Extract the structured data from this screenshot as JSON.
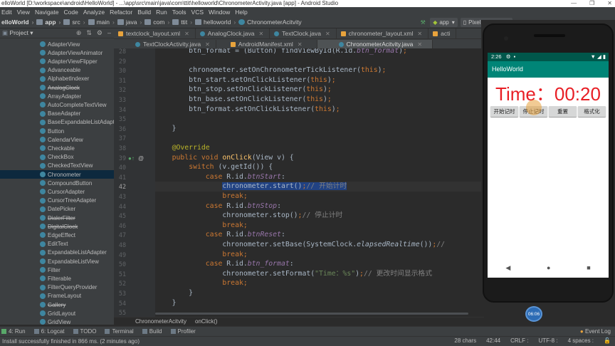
{
  "window": {
    "title": "elloWorld [D:\\workspace\\android\\HelloWorld] - ...\\app\\src\\main\\java\\com\\ttit\\helloworld\\ChronometerActivity.java [app] - Android Studio"
  },
  "menu": [
    "Edit",
    "View",
    "Navigate",
    "Code",
    "Analyze",
    "Refactor",
    "Build",
    "Run",
    "Tools",
    "VCS",
    "Window",
    "Help"
  ],
  "nav": {
    "crumbs": [
      "elloWorld",
      "app",
      "src",
      "main",
      "java",
      "com",
      "ttit",
      "helloworld",
      "ChronometerAcitvity"
    ],
    "run_config": "app",
    "device": "Pixel 2 API 28"
  },
  "project": {
    "header": "Project"
  },
  "tree": [
    {
      "label": "AdapterView",
      "strike": false
    },
    {
      "label": "AdapterViewAnimator",
      "strike": false
    },
    {
      "label": "AdapterViewFlipper",
      "strike": false
    },
    {
      "label": "Advanceable",
      "strike": false
    },
    {
      "label": "AlphabetIndexer",
      "strike": false
    },
    {
      "label": "AnalogClock",
      "strike": true
    },
    {
      "label": "ArrayAdapter",
      "strike": false
    },
    {
      "label": "AutoCompleteTextView",
      "strike": false
    },
    {
      "label": "BaseAdapter",
      "strike": false
    },
    {
      "label": "BaseExpandableListAdapter",
      "strike": false
    },
    {
      "label": "Button",
      "strike": false
    },
    {
      "label": "CalendarView",
      "strike": false
    },
    {
      "label": "Checkable",
      "strike": false
    },
    {
      "label": "CheckBox",
      "strike": false
    },
    {
      "label": "CheckedTextView",
      "strike": false
    },
    {
      "label": "Chronometer",
      "strike": false
    },
    {
      "label": "CompoundButton",
      "strike": false
    },
    {
      "label": "CursorAdapter",
      "strike": false
    },
    {
      "label": "CursorTreeAdapter",
      "strike": false
    },
    {
      "label": "DatePicker",
      "strike": false
    },
    {
      "label": "DialerFilter",
      "strike": true
    },
    {
      "label": "DigitalClock",
      "strike": true
    },
    {
      "label": "EdgeEffect",
      "strike": false
    },
    {
      "label": "EditText",
      "strike": false
    },
    {
      "label": "ExpandableListAdapter",
      "strike": false
    },
    {
      "label": "ExpandableListView",
      "strike": false
    },
    {
      "label": "Filter",
      "strike": false
    },
    {
      "label": "Filterable",
      "strike": false
    },
    {
      "label": "FilterQueryProvider",
      "strike": false
    },
    {
      "label": "FrameLayout",
      "strike": false
    },
    {
      "label": "Gallery",
      "strike": true
    },
    {
      "label": "GridLayout",
      "strike": false
    },
    {
      "label": "GridView",
      "strike": false
    }
  ],
  "tree_selected": "Chronometer",
  "tabs_row1": [
    "textclock_layout.xml",
    "AnalogClock.java",
    "TextClock.java",
    "chronometer_layout.xml",
    "acti"
  ],
  "tabs_row2": [
    "TextClockActivity.java",
    "AndroidManifest.xml",
    "ChronometerAcitvity.java"
  ],
  "active_tab": "ChronometerAcitvity.java",
  "line_numbers": [
    "28",
    "29",
    "30",
    "31",
    "32",
    "33",
    "34",
    "35",
    "36",
    "37",
    "38",
    "39",
    "40",
    "41",
    "42",
    "43",
    "44",
    "45",
    "46",
    "47",
    "48",
    "49",
    "50",
    "51",
    "52",
    "53",
    "54",
    "55"
  ],
  "current_line": "42",
  "code": [
    "        btn_format = (Button) findViewById(R.id.btn_format);",
    "",
    "        chronometer.setOnChronometerTickListener(this);",
    "        btn_start.setOnClickListener(this);",
    "        btn_stop.setOnClickListener(this);",
    "        btn_base.setOnClickListener(this);",
    "        btn_format.setOnClickListener(this);",
    "",
    "    }",
    "",
    "    @Override",
    "    public void onClick(View v) {",
    "        switch (v.getId()) {",
    "            case R.id.btnStart:",
    "                chronometer.start();// 开始计时",
    "                break;",
    "            case R.id.btnStop:",
    "                chronometer.stop();// 停止计时",
    "                break;",
    "            case R.id.btnReset:",
    "                chronometer.setBase(SystemClock.elapsedRealtime());// ",
    "                break;",
    "            case R.id.btn_format:",
    "                chronometer.setFormat(\"Time：%s\");// 更改时间显示格式",
    "                break;",
    "        }",
    "    }",
    ""
  ],
  "editor_crumbs": [
    "ChronometerAcitvity",
    "onClick()"
  ],
  "bottom_tools": [
    "4: Run",
    "6: Logcat",
    "TODO",
    "Terminal",
    "Build",
    "Profiler"
  ],
  "event_log": "Event Log",
  "status": {
    "message": "Install successfully finished in 866 ms. (2 minutes ago)",
    "chars": "28 chars",
    "position": "42:44",
    "line_sep": "CRLF :",
    "encoding": "UTF-8 :",
    "indent": "4 spaces :"
  },
  "phone": {
    "clock": "2:26",
    "app_title": "HelloWorld",
    "time_display": "Time：00:20",
    "buttons": [
      "开始记时",
      "停止记时",
      "重置",
      "格式化"
    ]
  },
  "recorder_time": "06:06",
  "colors": {
    "accent": "#008577",
    "status_bar": "#00574b",
    "time_text": "#e81e25",
    "ide_bg": "#2b2b2b",
    "panel": "#3c3f41"
  }
}
